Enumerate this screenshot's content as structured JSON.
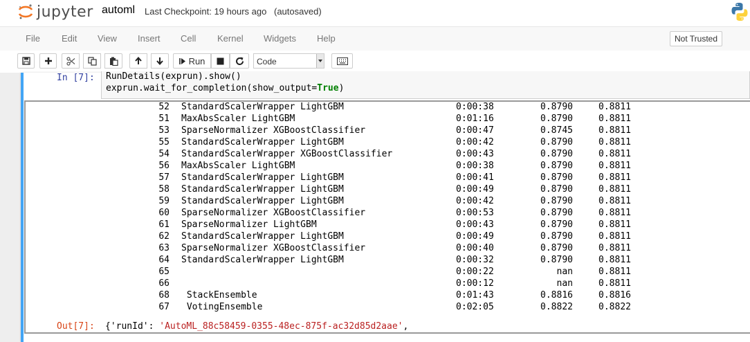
{
  "header": {
    "logo_text": "jupyter",
    "notebook_name": "automl",
    "checkpoint": "Last Checkpoint: 19 hours ago",
    "autosave": "(autosaved)"
  },
  "menu": {
    "items": [
      "File",
      "Edit",
      "View",
      "Insert",
      "Cell",
      "Kernel",
      "Widgets",
      "Help"
    ],
    "trust": "Not Trusted"
  },
  "toolbar": {
    "run_label": "Run",
    "cell_type": "Code"
  },
  "cell": {
    "in_prompt": "In [7]:",
    "code_line1": "RunDetails(exprun).show()",
    "code_line2_prefix": "exprun.wait_for_completion(show_output=",
    "code_line2_kw": "True",
    "code_line2_suffix": ")",
    "out_prompt": "Out[7]:",
    "out_prefix": "{'runId': ",
    "out_string": "'AutoML_88c58459-0355-48ec-875f-ac32d85d2aae'",
    "out_suffix": ","
  },
  "output_rows": [
    {
      "iter": "52",
      "pipeline": "StandardScalerWrapper LightGBM",
      "duration": "0:00:38",
      "metric": "0.8790",
      "best": "0.8811"
    },
    {
      "iter": "51",
      "pipeline": "MaxAbsScaler LightGBM",
      "duration": "0:01:16",
      "metric": "0.8790",
      "best": "0.8811"
    },
    {
      "iter": "53",
      "pipeline": "SparseNormalizer XGBoostClassifier",
      "duration": "0:00:47",
      "metric": "0.8745",
      "best": "0.8811"
    },
    {
      "iter": "55",
      "pipeline": "StandardScalerWrapper LightGBM",
      "duration": "0:00:42",
      "metric": "0.8790",
      "best": "0.8811"
    },
    {
      "iter": "54",
      "pipeline": "StandardScalerWrapper XGBoostClassifier",
      "duration": "0:00:43",
      "metric": "0.8790",
      "best": "0.8811"
    },
    {
      "iter": "56",
      "pipeline": "MaxAbsScaler LightGBM",
      "duration": "0:00:38",
      "metric": "0.8790",
      "best": "0.8811"
    },
    {
      "iter": "57",
      "pipeline": "StandardScalerWrapper LightGBM",
      "duration": "0:00:41",
      "metric": "0.8790",
      "best": "0.8811"
    },
    {
      "iter": "58",
      "pipeline": "StandardScalerWrapper LightGBM",
      "duration": "0:00:49",
      "metric": "0.8790",
      "best": "0.8811"
    },
    {
      "iter": "59",
      "pipeline": "StandardScalerWrapper LightGBM",
      "duration": "0:00:42",
      "metric": "0.8790",
      "best": "0.8811"
    },
    {
      "iter": "60",
      "pipeline": "SparseNormalizer XGBoostClassifier",
      "duration": "0:00:53",
      "metric": "0.8790",
      "best": "0.8811"
    },
    {
      "iter": "61",
      "pipeline": "SparseNormalizer LightGBM",
      "duration": "0:00:43",
      "metric": "0.8790",
      "best": "0.8811"
    },
    {
      "iter": "62",
      "pipeline": "StandardScalerWrapper LightGBM",
      "duration": "0:00:49",
      "metric": "0.8790",
      "best": "0.8811"
    },
    {
      "iter": "63",
      "pipeline": "SparseNormalizer XGBoostClassifier",
      "duration": "0:00:40",
      "metric": "0.8790",
      "best": "0.8811"
    },
    {
      "iter": "64",
      "pipeline": "StandardScalerWrapper LightGBM",
      "duration": "0:00:32",
      "metric": "0.8790",
      "best": "0.8811"
    },
    {
      "iter": "65",
      "pipeline": "",
      "duration": "0:00:22",
      "metric": "nan",
      "best": "0.8811"
    },
    {
      "iter": "66",
      "pipeline": "",
      "duration": "0:00:12",
      "metric": "nan",
      "best": "0.8811"
    },
    {
      "iter": "68",
      "pipeline": " StackEnsemble",
      "duration": "0:01:43",
      "metric": "0.8816",
      "best": "0.8816"
    },
    {
      "iter": "67",
      "pipeline": " VotingEnsemble",
      "duration": "0:02:05",
      "metric": "0.8822",
      "best": "0.8822"
    }
  ],
  "colors": {
    "cell_bar": "#42a5f5",
    "in_prompt": "#303f9f",
    "out_prompt": "#d84315"
  }
}
